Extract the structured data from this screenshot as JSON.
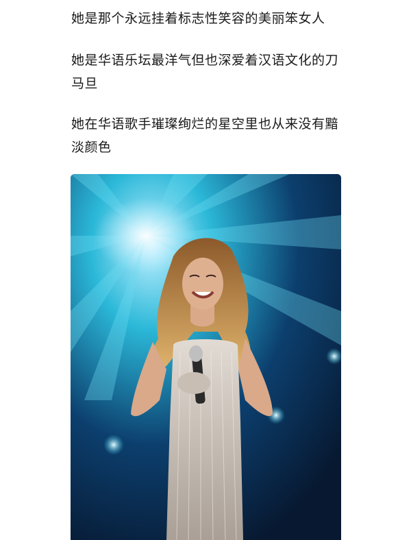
{
  "article": {
    "paragraphs": [
      "她是那个永远挂着标志性笑容的美丽笨女人",
      "她是华语乐坛最洋气但也深爱着汉语文化的刀马旦",
      "她在华语歌手璀璨绚烂的星空里也从来没有黯淡颜色"
    ]
  },
  "photo": {
    "alt": "",
    "colors": {
      "stage_dark": "#071830",
      "stage_light": "#2bb8d8",
      "glow": "#e8fbff",
      "hair": "#c9924a",
      "dress": "#cfc6bd",
      "skin": "#d9a98a"
    }
  }
}
